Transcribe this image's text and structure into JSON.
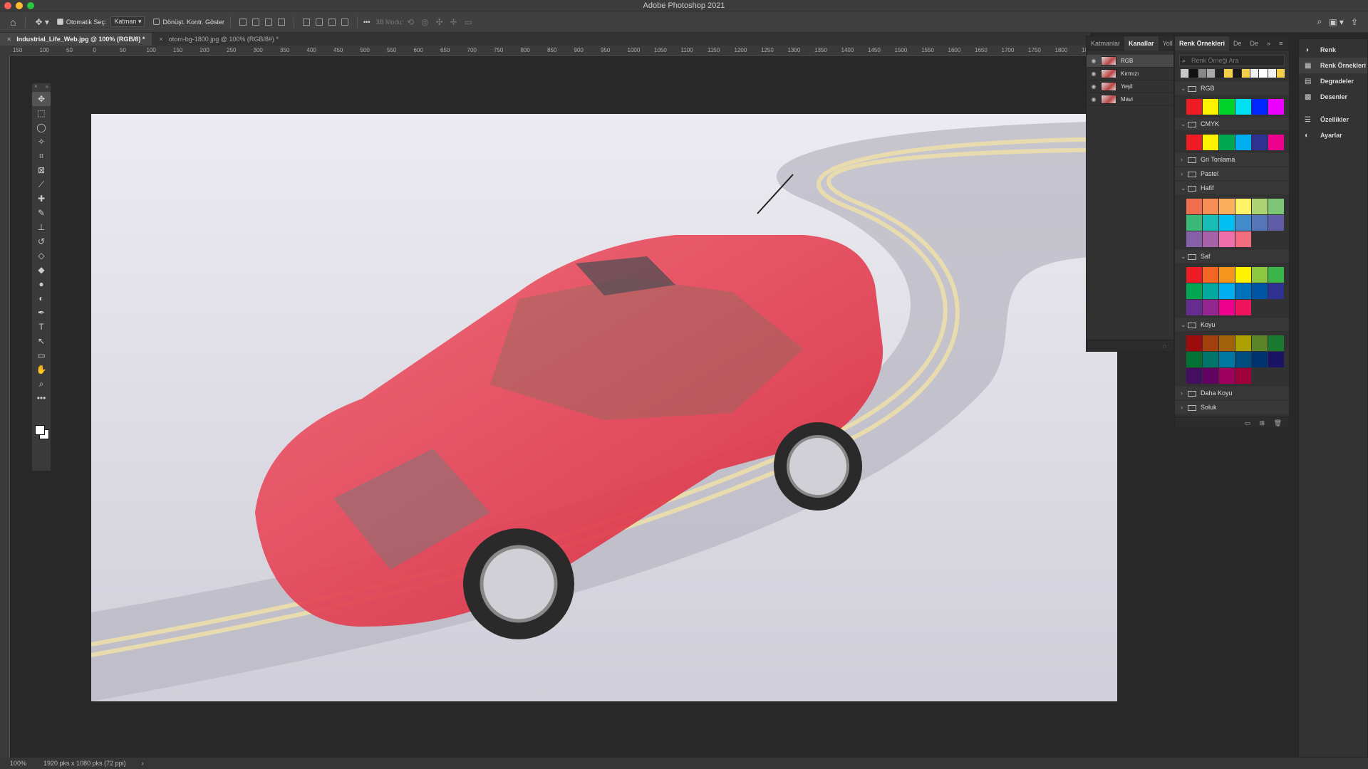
{
  "window": {
    "title": "Adobe Photoshop 2021"
  },
  "options_bar": {
    "auto_select_label": "Otomatik Seç:",
    "auto_select_value": "Katman",
    "transform_controls_label": "Dönüşt. Kontr. Göster",
    "mode3d_label": "3B Modu:",
    "more_label": "•••"
  },
  "document_tabs": [
    {
      "label": "Industrial_Life_Web.jpg @ 100% (RGB/8) *",
      "active": true
    },
    {
      "label": "otom-bg-1800.jpg @ 100% (RGB/8#) *",
      "active": false
    }
  ],
  "ruler": {
    "labels": [
      "150",
      "100",
      "50",
      "0",
      "50",
      "100",
      "150",
      "200",
      "250",
      "300",
      "350",
      "400",
      "450",
      "500",
      "550",
      "600",
      "650",
      "700",
      "750",
      "800",
      "850",
      "900",
      "950",
      "1000",
      "1050",
      "1100",
      "1150",
      "1200",
      "1250",
      "1300",
      "1350",
      "1400",
      "1450",
      "1500",
      "1550",
      "1600",
      "1650",
      "1700",
      "1750",
      "1800",
      "18"
    ]
  },
  "tools": [
    "move-icon",
    "marquee-icon",
    "lasso-icon",
    "magic-wand-icon",
    "crop-icon",
    "frame-icon",
    "eyedropper-icon",
    "healing-icon",
    "brush-icon",
    "stamp-icon",
    "history-brush-icon",
    "eraser-icon",
    "paint-bucket-icon",
    "blur-icon",
    "dodge-icon",
    "pen-icon",
    "type-icon",
    "path-select-icon",
    "rectangle-icon",
    "hand-icon",
    "zoom-icon",
    "more-tools-icon"
  ],
  "channels_panel": {
    "tabs": [
      "Katmanlar",
      "Kanallar",
      "Yoll",
      "Re"
    ],
    "active_tab": "Kanallar",
    "channels": [
      {
        "name": "RGB"
      },
      {
        "name": "Kırmızı"
      },
      {
        "name": "Yeşil"
      },
      {
        "name": "Mavi"
      }
    ]
  },
  "swatches_panel": {
    "tabs": [
      "Renk Örnekleri",
      "De",
      "De"
    ],
    "active_tab": "Renk Örnekleri",
    "search_placeholder": "Renk Örneği Ara",
    "recent": [
      "#c8c8c8",
      "#111111",
      "#888888",
      "#aaaaaa",
      "#222222",
      "#f5d04a",
      "#1a1a1a",
      "#f5d04a",
      "#f0f0f0",
      "#ffffff",
      "#f0f0f0",
      "#f5d04a"
    ],
    "groups": [
      {
        "name": "RGB",
        "expanded": true,
        "colors": [
          "#ed1c24",
          "#fff200",
          "#00d22a",
          "#00e0f0",
          "#0028ff",
          "#ec00ff"
        ]
      },
      {
        "name": "CMYK",
        "expanded": true,
        "colors": [
          "#ed1c24",
          "#fff200",
          "#00a650",
          "#00aeef",
          "#2e3192",
          "#ec008c"
        ]
      },
      {
        "name": "Gri Tonlama",
        "expanded": false,
        "colors": []
      },
      {
        "name": "Pastel",
        "expanded": false,
        "colors": []
      },
      {
        "name": "Hafif",
        "expanded": true,
        "colors": [
          "#f26c4f",
          "#f68e55",
          "#fbaf5c",
          "#fff467",
          "#acd372",
          "#7cc576",
          "#3bb878",
          "#1abbb4",
          "#00bff3",
          "#438ccb",
          "#5574b9",
          "#605ca8",
          "#855fa8",
          "#a763a8",
          "#f06ea9",
          "#f26d7d"
        ]
      },
      {
        "name": "Saf",
        "expanded": true,
        "colors": [
          "#ed1c24",
          "#f26522",
          "#f7941d",
          "#fff200",
          "#8dc63f",
          "#39b54a",
          "#00a651",
          "#00a99d",
          "#00aeef",
          "#0072bc",
          "#0054a6",
          "#2e3192",
          "#662d91",
          "#92278f",
          "#ec008c",
          "#ed145b"
        ]
      },
      {
        "name": "Koyu",
        "expanded": true,
        "colors": [
          "#9e0b0f",
          "#a0410d",
          "#a36209",
          "#aba000",
          "#598527",
          "#1a7b30",
          "#007236",
          "#00746b",
          "#0076a3",
          "#004b80",
          "#003471",
          "#1b1464",
          "#440e62",
          "#630460",
          "#9e005d",
          "#9e0039"
        ]
      },
      {
        "name": "Daha Koyu",
        "expanded": false,
        "colors": []
      },
      {
        "name": "Soluk",
        "expanded": false,
        "colors": []
      }
    ]
  },
  "right_panel": {
    "items": [
      {
        "label": "Renk",
        "icon": "color-wheel-icon",
        "active": false
      },
      {
        "label": "Renk Örnekleri",
        "icon": "swatches-icon",
        "active": true
      },
      {
        "label": "Degradeler",
        "icon": "gradient-icon",
        "active": false
      },
      {
        "label": "Desenler",
        "icon": "pattern-icon",
        "active": false
      },
      {
        "label": "Özellikler",
        "icon": "properties-icon",
        "active": false
      },
      {
        "label": "Ayarlar",
        "icon": "adjustments-icon",
        "active": false
      }
    ]
  },
  "status": {
    "zoom": "100%",
    "info": "1920 pks x 1080 pks (72 ppi)",
    "arrow": "›"
  }
}
